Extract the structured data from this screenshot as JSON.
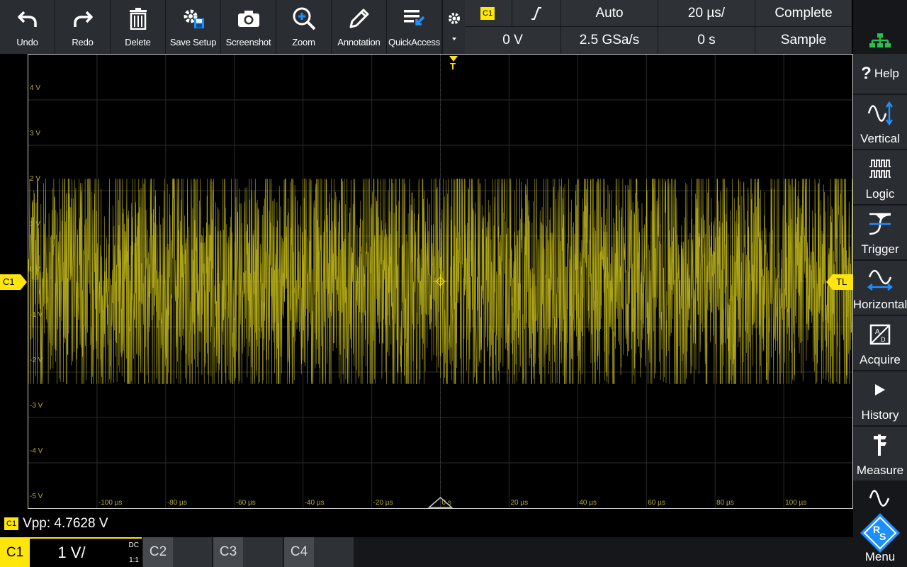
{
  "toolbar": {
    "buttons": [
      {
        "label": "Undo",
        "icon": "undo-icon"
      },
      {
        "label": "Redo",
        "icon": "redo-icon"
      },
      {
        "label": "Delete",
        "icon": "trash-icon"
      },
      {
        "label": "Save Setup",
        "icon": "save-setup-icon"
      },
      {
        "label": "Screenshot",
        "icon": "camera-icon"
      },
      {
        "label": "Zoom",
        "icon": "zoom-icon"
      },
      {
        "label": "Annotation",
        "icon": "pen-icon"
      },
      {
        "label": "QuickAccess",
        "icon": "quickaccess-icon"
      }
    ]
  },
  "settings": {
    "trigger_source": "C1",
    "trigger_slope": "rising-edge",
    "trigger_mode": "Auto",
    "time_scale": "20 µs/",
    "acq_state": "Complete",
    "trigger_level": "0 V",
    "sample_rate": "2.5 GSa/s",
    "horizontal_position": "0 s",
    "acq_mode": "Sample"
  },
  "waveform": {
    "channel_label": "C1",
    "trigger_level_label": "TL",
    "trigger_marker": "T",
    "y_ticks": [
      "4 V",
      "3 V",
      "2 V",
      "1 V",
      "0 V",
      "-1 V",
      "-2 V",
      "-3 V",
      "-4 V",
      "-5 V"
    ],
    "x_ticks": [
      "-100 µs",
      "-80 µs",
      "-60 µs",
      "-40 µs",
      "-20 µs",
      "0 s",
      "20 µs",
      "40 µs",
      "60 µs",
      "80 µs",
      "100 µs"
    ],
    "trace_color": "#ccc21a",
    "amplitude_v": 2.38
  },
  "sidemenu": {
    "items": [
      {
        "label": "Help",
        "icon": "help-icon"
      },
      {
        "label": "Vertical",
        "icon": "vertical-icon"
      },
      {
        "label": "Logic",
        "icon": "logic-icon"
      },
      {
        "label": "Trigger",
        "icon": "trigger-icon"
      },
      {
        "label": "Horizontal",
        "icon": "horizontal-icon"
      },
      {
        "label": "Acquire",
        "icon": "acquire-icon"
      },
      {
        "label": "History",
        "icon": "history-icon"
      },
      {
        "label": "Measure",
        "icon": "measure-icon"
      },
      {
        "label": "Menu",
        "icon": "rs-logo-icon"
      }
    ]
  },
  "measurement": {
    "channel": "C1",
    "text": "Vpp: 4.7628 V"
  },
  "channels": [
    {
      "name": "C1",
      "scale": "1 V/",
      "coupling": "DC",
      "probe": "1:1",
      "active": true
    },
    {
      "name": "C2",
      "active": false
    },
    {
      "name": "C3",
      "active": false
    },
    {
      "name": "C4",
      "active": false
    }
  ],
  "colors": {
    "channel1": "#ffe60a",
    "accent_blue": "#1e8fff",
    "network_green": "#27c24c"
  }
}
